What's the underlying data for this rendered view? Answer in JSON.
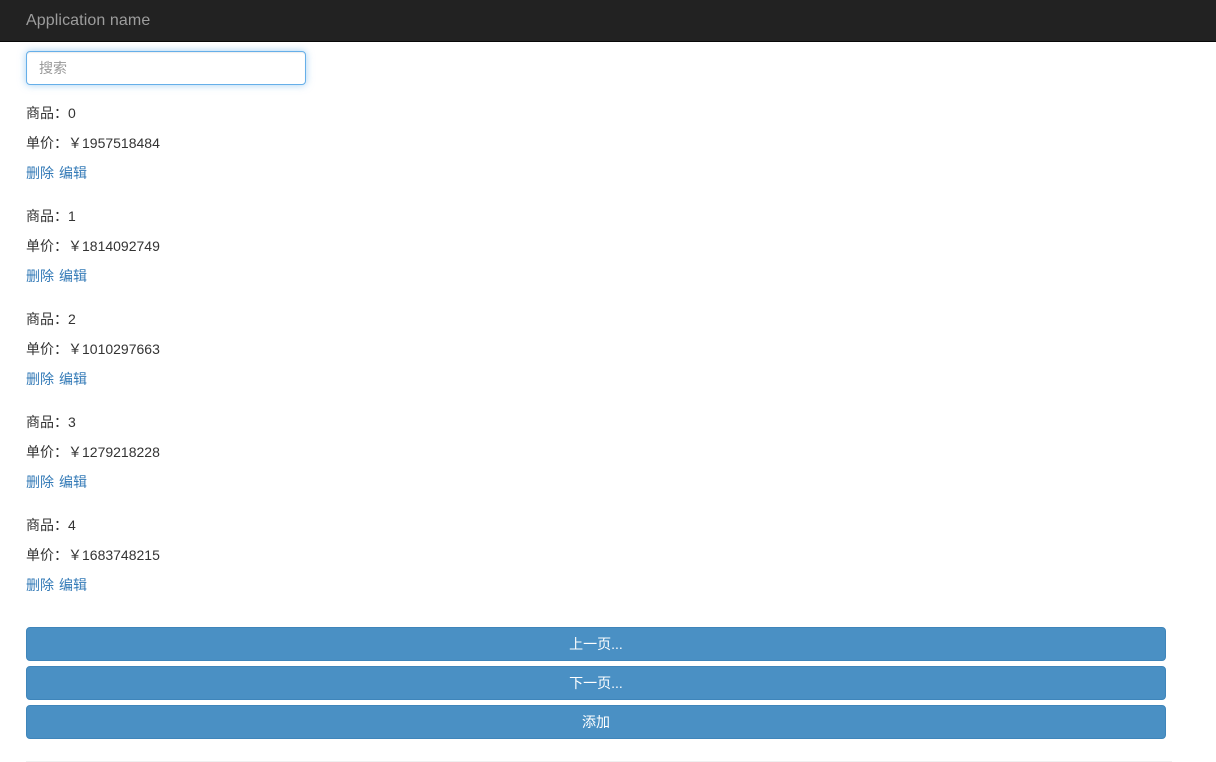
{
  "header": {
    "brand": "Application name"
  },
  "search": {
    "placeholder": "搜索",
    "value": ""
  },
  "list": {
    "name_label": "商品：",
    "price_label": "单价：",
    "currency": "￥",
    "delete_label": "删除",
    "edit_label": "编辑",
    "items": [
      {
        "name": "0",
        "price": "1957518484"
      },
      {
        "name": "1",
        "price": "1814092749"
      },
      {
        "name": "2",
        "price": "1010297663"
      },
      {
        "name": "3",
        "price": "1279218228"
      },
      {
        "name": "4",
        "price": "1683748215"
      }
    ]
  },
  "buttons": {
    "prev_page": "上一页...",
    "next_page": "下一页...",
    "add": "添加"
  },
  "colors": {
    "navbar_bg": "#222222",
    "brand_text": "#9d9d9d",
    "link": "#337ab7",
    "button_bg": "#4a90c4",
    "input_focus_border": "#66afe9",
    "body_text": "#333333"
  }
}
